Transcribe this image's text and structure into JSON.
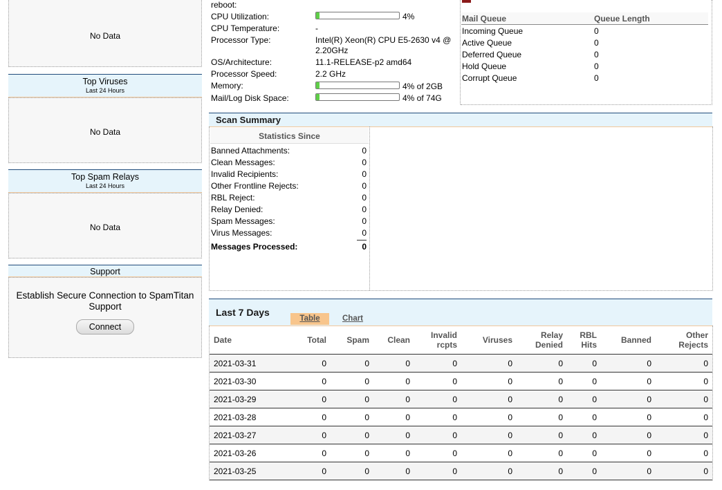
{
  "left": {
    "no_data_text": "No Data",
    "top_viruses": {
      "title": "Top Viruses",
      "subtitle": "Last 24 Hours"
    },
    "top_spam_relays": {
      "title": "Top Spam Relays",
      "subtitle": "Last 24 Hours"
    },
    "support": {
      "title": "Support",
      "text": "Establish Secure Connection to SpamTitan Support",
      "button": "Connect"
    }
  },
  "system": {
    "reboot_label": "reboot:",
    "cpu_util_label": "CPU Utilization:",
    "cpu_util_value": "4%",
    "cpu_util_pct": 4,
    "cpu_temp_label": "CPU Temperature:",
    "cpu_temp_value": "-",
    "proc_type_label": "Processor Type:",
    "proc_type_value": "Intel(R) Xeon(R) CPU E5-2630 v4 @ 2.20GHz",
    "os_label": "OS/Architecture:",
    "os_value": "11.1-RELEASE-p2 amd64",
    "proc_speed_label": "Processor Speed:",
    "proc_speed_value": "2.2 GHz",
    "memory_label": "Memory:",
    "memory_value": "4% of 2GB",
    "memory_pct": 4,
    "disk_label": "Mail/Log Disk Space:",
    "disk_value": "4% of 74G",
    "disk_pct": 4
  },
  "mail_queue": {
    "header_name": "Mail Queue",
    "header_len": "Queue Length",
    "rows": [
      {
        "name": "Incoming Queue",
        "value": "0"
      },
      {
        "name": "Active Queue",
        "value": "0"
      },
      {
        "name": "Deferred Queue",
        "value": "0"
      },
      {
        "name": "Hold Queue",
        "value": "0"
      },
      {
        "name": "Corrupt Queue",
        "value": "0"
      }
    ]
  },
  "scan_summary": {
    "title": "Scan Summary",
    "stats_since": "Statistics Since",
    "rows": [
      {
        "label": "Banned Attachments:",
        "value": "0"
      },
      {
        "label": "Clean Messages:",
        "value": "0"
      },
      {
        "label": "Invalid Recipients:",
        "value": "0"
      },
      {
        "label": "Other Frontline Rejects:",
        "value": "0"
      },
      {
        "label": "RBL Reject:",
        "value": "0"
      },
      {
        "label": "Relay Denied:",
        "value": "0"
      },
      {
        "label": "Spam Messages:",
        "value": "0"
      },
      {
        "label": "Virus Messages:",
        "value": "0"
      }
    ],
    "total_label": "Messages Processed:",
    "total_value": "0"
  },
  "last7": {
    "title": "Last 7 Days",
    "tab_table": "Table",
    "tab_chart": "Chart",
    "headers": [
      "Date",
      "Total",
      "Spam",
      "Clean",
      "Invalid rcpts",
      "Viruses",
      "Relay Denied",
      "RBL Hits",
      "Banned",
      "Other Rejects"
    ],
    "rows": [
      [
        "2021-03-31",
        "0",
        "0",
        "0",
        "0",
        "0",
        "0",
        "0",
        "0",
        "0"
      ],
      [
        "2021-03-30",
        "0",
        "0",
        "0",
        "0",
        "0",
        "0",
        "0",
        "0",
        "0"
      ],
      [
        "2021-03-29",
        "0",
        "0",
        "0",
        "0",
        "0",
        "0",
        "0",
        "0",
        "0"
      ],
      [
        "2021-03-28",
        "0",
        "0",
        "0",
        "0",
        "0",
        "0",
        "0",
        "0",
        "0"
      ],
      [
        "2021-03-27",
        "0",
        "0",
        "0",
        "0",
        "0",
        "0",
        "0",
        "0",
        "0"
      ],
      [
        "2021-03-26",
        "0",
        "0",
        "0",
        "0",
        "0",
        "0",
        "0",
        "0",
        "0"
      ],
      [
        "2021-03-25",
        "0",
        "0",
        "0",
        "0",
        "0",
        "0",
        "0",
        "0",
        "0"
      ]
    ]
  }
}
